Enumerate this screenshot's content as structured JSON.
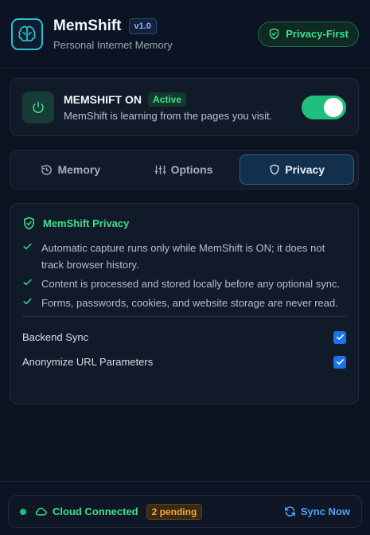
{
  "header": {
    "title": "MemShift",
    "version": "v1.0",
    "subtitle": "Personal Internet Memory",
    "privacy_badge": "Privacy-First"
  },
  "status": {
    "title": "MEMSHIFT ON",
    "badge": "Active",
    "description": "MemShift is learning from the pages you visit.",
    "enabled": true
  },
  "tabs": [
    {
      "label": "Memory",
      "icon": "history-icon",
      "active": false
    },
    {
      "label": "Options",
      "icon": "sliders-icon",
      "active": false
    },
    {
      "label": "Privacy",
      "icon": "shield-icon",
      "active": true
    }
  ],
  "privacy_panel": {
    "title": "MemShift Privacy",
    "bullets": [
      "Automatic capture runs only while MemShift is ON; it does not track browser history.",
      "Content is processed and stored locally before any optional sync.",
      "Forms, passwords, cookies, and website storage are never read."
    ],
    "options": [
      {
        "label": "Backend Sync",
        "checked": true
      },
      {
        "label": "Anonymize URL Parameters",
        "checked": true
      }
    ]
  },
  "footer": {
    "connection": "Cloud Connected",
    "pending": "2 pending",
    "sync_label": "Sync Now"
  },
  "colors": {
    "accent_green": "#3ee08c",
    "accent_blue": "#4ea3ff",
    "background": "#0b1220",
    "pending_orange": "#f2a93b"
  }
}
